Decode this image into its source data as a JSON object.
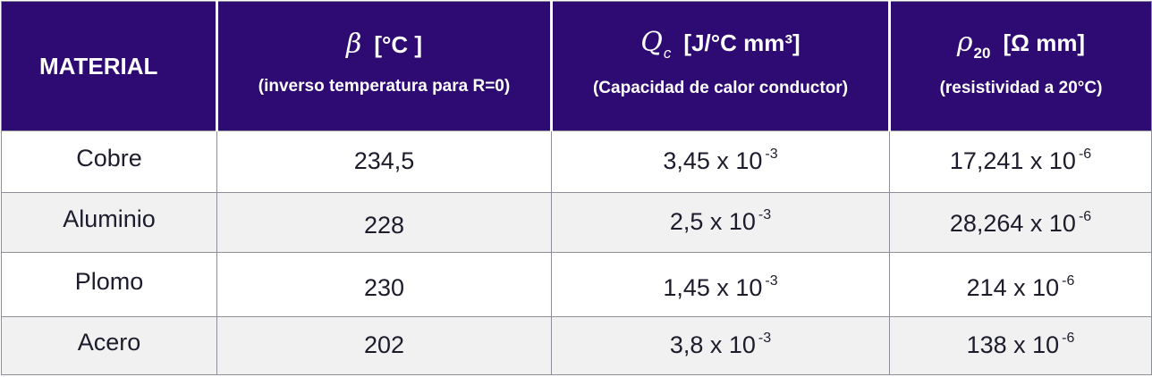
{
  "header": {
    "material": "MATERIAL",
    "beta": {
      "symbol": "β",
      "unit": "[°C ]",
      "description": "(inverso temperatura para R=0)"
    },
    "qc": {
      "symbol": "Q",
      "subscript": "c",
      "unit": "[J/°C mm³]",
      "description": "(Capacidad de calor conductor)"
    },
    "rho": {
      "symbol": "ρ",
      "subscript": "20",
      "unit": "[Ω mm]",
      "description": "(resistividad a 20°C)"
    }
  },
  "rows": [
    {
      "material": "Cobre",
      "beta": "234,5",
      "qc": {
        "mantissa": "3,45 x 10",
        "exp": "-3"
      },
      "rho": {
        "mantissa": "17,241 x 10",
        "exp": "-6"
      }
    },
    {
      "material": "Aluminio",
      "beta": "228",
      "qc": {
        "mantissa": "2,5 x 10",
        "exp": "-3"
      },
      "rho": {
        "mantissa": "28,264 x 10",
        "exp": "-6"
      }
    },
    {
      "material": "Plomo",
      "beta": "230",
      "qc": {
        "mantissa": "1,45 x 10",
        "exp": "-3"
      },
      "rho": {
        "mantissa": "214 x 10",
        "exp": "-6"
      }
    },
    {
      "material": "Acero",
      "beta": "202",
      "qc": {
        "mantissa": "3,8 x 10",
        "exp": "-3"
      },
      "rho": {
        "mantissa": "138 x 10",
        "exp": "-6"
      }
    }
  ],
  "colors": {
    "header_bg": "#2e0a73",
    "header_text": "#ffffff",
    "row_alt_bg": "#f1f1f1",
    "border": "#8f8f99",
    "body_text": "#1c1c2c"
  }
}
